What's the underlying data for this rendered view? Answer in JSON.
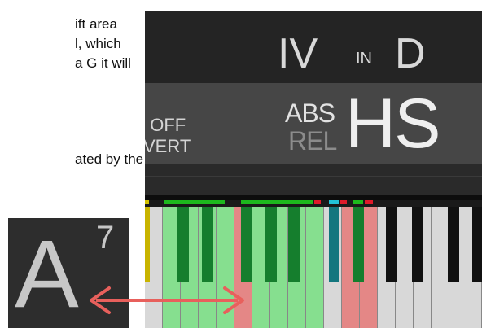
{
  "doc_text": {
    "line1": "ift area",
    "line2": "l, which",
    "line3": "a G it will",
    "line4": "ated by the"
  },
  "plugin": {
    "chord_name": {
      "numeral": "IV",
      "in_word": "IN",
      "key": "D"
    },
    "mode": {
      "left_top": "I OFF",
      "left_bottom": "VERT",
      "abs_label": "ABS",
      "rel_label": "REL",
      "mode_big": "HS"
    }
  },
  "chord_box": {
    "root": "A",
    "extension": "7"
  },
  "colors": {
    "green_key": "#86df8f",
    "red_key": "#e48786",
    "dark_green_key": "#157e2d",
    "teal_key": "#13767e",
    "yellow_key": "#c8b400",
    "ind_green": "#1db81d",
    "ind_red": "#e01a2a",
    "ind_cyan": "#22c2d8",
    "arrow": "#e8605c"
  }
}
